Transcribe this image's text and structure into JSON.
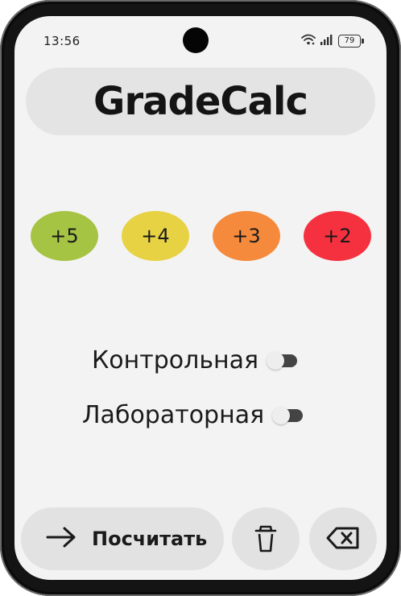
{
  "status_bar": {
    "time": "13:56",
    "battery": "79",
    "icons": [
      "wifi-icon",
      "signal-icon",
      "battery-icon"
    ]
  },
  "app": {
    "title": "GradeCalc"
  },
  "grades": [
    {
      "label": "+5",
      "color": "#a5c444"
    },
    {
      "label": "+4",
      "color": "#e7d243"
    },
    {
      "label": "+3",
      "color": "#f58a3c"
    },
    {
      "label": "+2",
      "color": "#f5313f"
    }
  ],
  "toggles": [
    {
      "label": "Контрольная",
      "on": false
    },
    {
      "label": "Лабораторная",
      "on": false
    }
  ],
  "actions": {
    "calculate_label": "Посчитать",
    "calculate_icon": "arrow-right-icon",
    "clear_icon": "trash-icon",
    "backspace_icon": "backspace-icon"
  }
}
